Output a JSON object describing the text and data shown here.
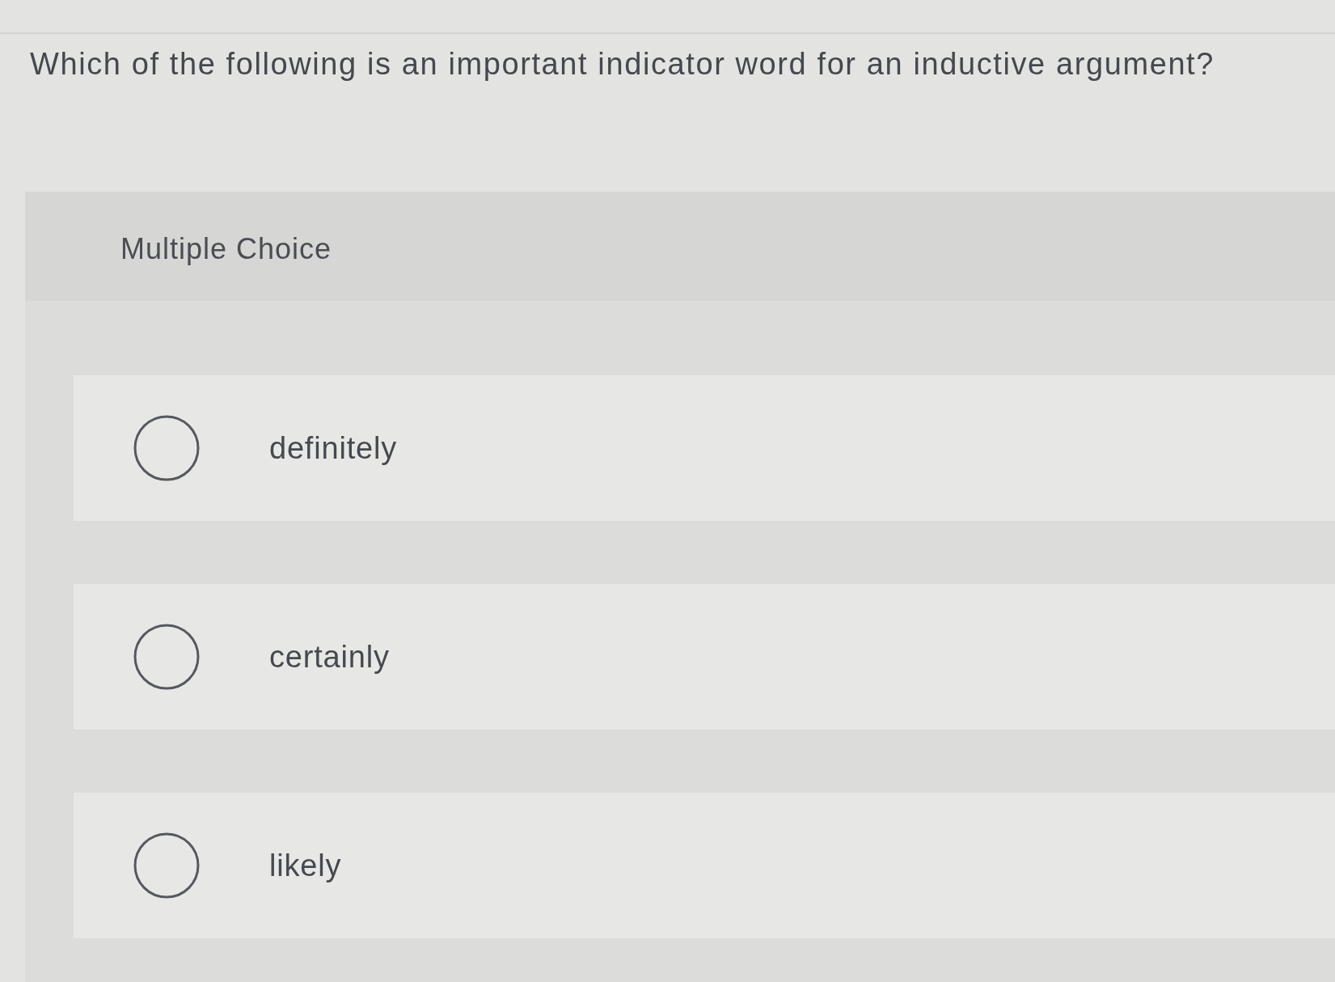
{
  "question": {
    "text": "Which of the following is an important indicator word for an inductive argument?"
  },
  "answer_panel": {
    "header": "Multiple Choice",
    "options": [
      {
        "label": "definitely",
        "selected": false
      },
      {
        "label": "certainly",
        "selected": false
      },
      {
        "label": "likely",
        "selected": false
      }
    ]
  }
}
